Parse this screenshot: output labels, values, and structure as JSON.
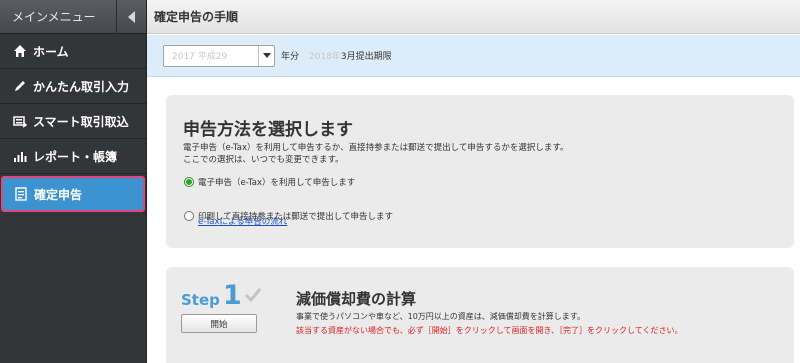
{
  "sidebar": {
    "header_label": "メインメニュー",
    "items": [
      {
        "label": "ホーム",
        "icon": "home-icon"
      },
      {
        "label": "かんたん取引入力",
        "icon": "pencil-icon"
      },
      {
        "label": "スマート取引取込",
        "icon": "import-icon"
      },
      {
        "label": "レポート・帳簿",
        "icon": "report-chart-icon"
      },
      {
        "label": "確定申告",
        "icon": "tax-return-icon",
        "active": true
      }
    ],
    "active_color": "#3d93cf",
    "highlight_border_color": "#e0457b"
  },
  "header": {
    "title": "確定申告の手順"
  },
  "year_bar": {
    "select_value": "2017 平成29",
    "year_label": "年分",
    "deadline_prefix": "2018年",
    "deadline_suffix": "3月提出期限"
  },
  "filing_method": {
    "title": "申告方法を選択します",
    "desc_line1": "電子申告（e-Tax）を利用して申告するか、直接持参または郵送で提出して申告するかを選択します。",
    "desc_line2": "ここでの選択は、いつでも変更できます。",
    "options": [
      {
        "label": "電子申告（e-Tax）を利用して申告します",
        "selected": true
      },
      {
        "label": "印刷して直接持参または郵送で提出して申告します",
        "selected": false
      }
    ],
    "etax_link": "e-Taxによる申告の流れ"
  },
  "step1": {
    "step_word": "Step",
    "step_number": "1",
    "start_button": "開始",
    "title": "減価償却費の計算",
    "desc": "事業で使うパソコンや車など、10万円以上の資産は、減価償却費を計算します。",
    "warning": "該当する資産がない場合でも、必ず［開始］をクリックして画面を開き、［完了］をクリックしてください。",
    "accent_color": "#4a9bd6",
    "warning_color": "#e02020"
  }
}
